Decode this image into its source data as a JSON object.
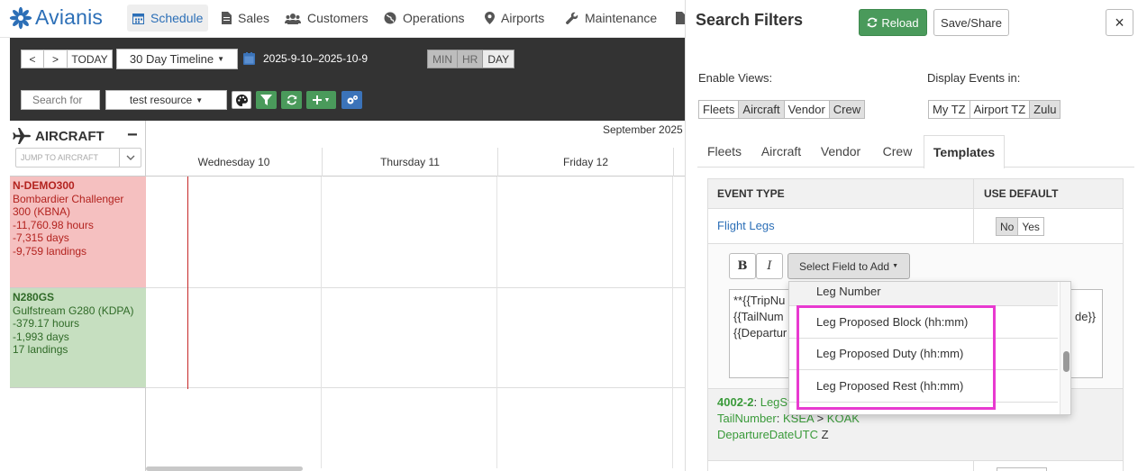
{
  "nav": {
    "brand": "Avianis",
    "items": [
      "Schedule",
      "Sales",
      "Customers",
      "Operations",
      "Airports",
      "Maintenance"
    ]
  },
  "toolbar": {
    "prev": "<",
    "next": ">",
    "today": "TODAY",
    "range_select": "30 Day Timeline",
    "date_range": "2025-9-10–2025-10-9",
    "scale": [
      "MIN",
      "HR",
      "DAY"
    ],
    "search_placeholder": "Search for",
    "resource_select": "test resource"
  },
  "grid": {
    "resource_header": "AIRCRAFT",
    "jump_placeholder": "JUMP TO AIRCRAFT",
    "month": "September 2025",
    "days": [
      "Wednesday 10",
      "Thursday 11",
      "Friday 12"
    ],
    "rows": [
      {
        "tail": "N-DEMO300",
        "lines": [
          "Bombardier Challenger",
          "300 (KBNA)",
          "-11,760.98 hours",
          "-7,315 days",
          "-9,759 landings"
        ]
      },
      {
        "tail": "N280GS",
        "lines": [
          "Gulfstream G280 (KDPA)",
          "-379.17 hours",
          "-1,993 days",
          "17 landings"
        ]
      }
    ]
  },
  "panel": {
    "title": "Search Filters",
    "reload": "Reload",
    "save_share": "Save/Share",
    "close": "×",
    "enable_views_label": "Enable Views:",
    "enable_views": [
      "Fleets",
      "Aircraft",
      "Vendor",
      "Crew"
    ],
    "display_events_label": "Display Events in:",
    "display_events": [
      "My TZ",
      "Airport TZ",
      "Zulu"
    ],
    "tabs": [
      "Fleets",
      "Aircraft",
      "Vendor",
      "Crew",
      "Templates"
    ],
    "table": {
      "col_event": "EVENT TYPE",
      "col_default": "USE DEFAULT",
      "row_label": "Flight Legs",
      "no": "No",
      "yes": "Yes"
    },
    "editor": {
      "bold": "B",
      "italic": "I",
      "select_field": "Select Field to Add",
      "line1": "**{{TripNu",
      "line2": "{{TailNum",
      "line2_end": "de}}",
      "line3": "{{Departur"
    },
    "dropdown": [
      "Leg Number",
      "Leg Proposed Block (hh:mm)",
      "Leg Proposed Duty (hh:mm)",
      "Leg Proposed Rest (hh:mm)"
    ],
    "preview": {
      "id": "4002-2",
      "sep": ": ",
      "leg_label": "LegSt",
      "tail_label": "TailNumber",
      "tail_sep": ": ",
      "from": "KSEA",
      "arrow": " > ",
      "to": "KOAK",
      "date_label": "DepartureDateUTC",
      "date_suffix": " Z"
    }
  },
  "colors": {
    "brand": "#2c6fb7",
    "row1_bg": "#f5c0c0",
    "row1_text": "#b3231f",
    "row2_bg": "#c6dfc0",
    "row2_text": "#2f6a27",
    "reload_bg": "#4a9a5b",
    "highlight": "#e83ad0",
    "now_line": "#c62828",
    "preview_green": "#3a9a3a"
  }
}
